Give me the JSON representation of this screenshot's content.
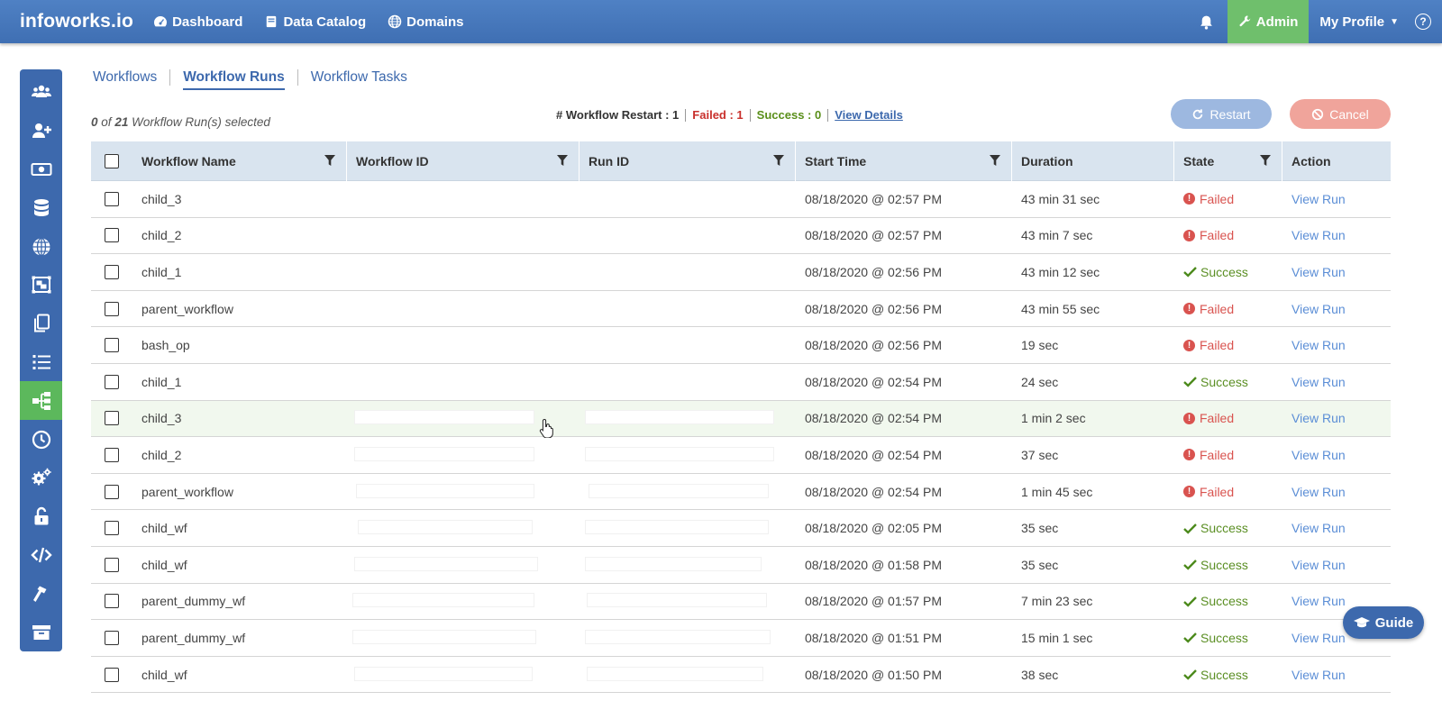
{
  "brand": "infoworks.io",
  "nav": {
    "dashboard": "Dashboard",
    "data_catalog": "Data Catalog",
    "domains": "Domains",
    "admin": "Admin",
    "profile": "My Profile",
    "help": "?"
  },
  "sidebar": {
    "icons": [
      "users-icon",
      "add-user-icon",
      "money-icon",
      "database-icon",
      "globe-icon",
      "object-group-icon",
      "copy-icon",
      "list-icon",
      "workflow-icon",
      "clock-icon",
      "settings-icon",
      "unlock-icon",
      "code-icon",
      "hammer-icon",
      "archive-icon"
    ],
    "active_index": 8
  },
  "tabs": {
    "workflows": "Workflows",
    "workflow_runs": "Workflow Runs",
    "workflow_tasks": "Workflow Tasks"
  },
  "selection": {
    "count": "0",
    "of": "of",
    "total": "21",
    "suffix": "Workflow Run(s) selected"
  },
  "summary": {
    "restart": "# Workflow Restart : 1",
    "failed": "Failed : 1",
    "success": "Success : 0",
    "details": "View Details"
  },
  "buttons": {
    "restart": "Restart",
    "cancel": "Cancel"
  },
  "columns": {
    "name": "Workflow Name",
    "wid": "Workflow ID",
    "rid": "Run ID",
    "start": "Start Time",
    "duration": "Duration",
    "state": "State",
    "action": "Action"
  },
  "rows": [
    {
      "name": "child_3",
      "start": "08/18/2020 @ 02:57 PM",
      "duration": "43 min 31 sec",
      "state": "Failed",
      "action": "View Run"
    },
    {
      "name": "child_2",
      "start": "08/18/2020 @ 02:57 PM",
      "duration": "43 min 7 sec",
      "state": "Failed",
      "action": "View Run"
    },
    {
      "name": "child_1",
      "start": "08/18/2020 @ 02:56 PM",
      "duration": "43 min 12 sec",
      "state": "Success",
      "action": "View Run"
    },
    {
      "name": "parent_workflow",
      "start": "08/18/2020 @ 02:56 PM",
      "duration": "43 min 55 sec",
      "state": "Failed",
      "action": "View Run"
    },
    {
      "name": "bash_op",
      "start": "08/18/2020 @ 02:56 PM",
      "duration": "19 sec",
      "state": "Failed",
      "action": "View Run"
    },
    {
      "name": "child_1",
      "start": "08/18/2020 @ 02:54 PM",
      "duration": "24 sec",
      "state": "Success",
      "action": "View Run"
    },
    {
      "name": "child_3",
      "start": "08/18/2020 @ 02:54 PM",
      "duration": "1 min 2 sec",
      "state": "Failed",
      "action": "View Run"
    },
    {
      "name": "child_2",
      "start": "08/18/2020 @ 02:54 PM",
      "duration": "37 sec",
      "state": "Failed",
      "action": "View Run"
    },
    {
      "name": "parent_workflow",
      "start": "08/18/2020 @ 02:54 PM",
      "duration": "1 min 45 sec",
      "state": "Failed",
      "action": "View Run"
    },
    {
      "name": "child_wf",
      "start": "08/18/2020 @ 02:05 PM",
      "duration": "35 sec",
      "state": "Success",
      "action": "View Run"
    },
    {
      "name": "child_wf",
      "start": "08/18/2020 @ 01:58 PM",
      "duration": "35 sec",
      "state": "Success",
      "action": "View Run"
    },
    {
      "name": "parent_dummy_wf",
      "start": "08/18/2020 @ 01:57 PM",
      "duration": "7 min 23 sec",
      "state": "Success",
      "action": "View Run"
    },
    {
      "name": "parent_dummy_wf",
      "start": "08/18/2020 @ 01:51 PM",
      "duration": "15 min 1 sec",
      "state": "Success",
      "action": "View Run"
    },
    {
      "name": "child_wf",
      "start": "08/18/2020 @ 01:50 PM",
      "duration": "38 sec",
      "state": "Success",
      "action": "View Run"
    }
  ],
  "guide": "Guide",
  "colors": {
    "brand_blue": "#3d69ad",
    "active_green": "#5cb85c",
    "failed_red": "#d9534f",
    "success_green": "#5b8f24"
  }
}
